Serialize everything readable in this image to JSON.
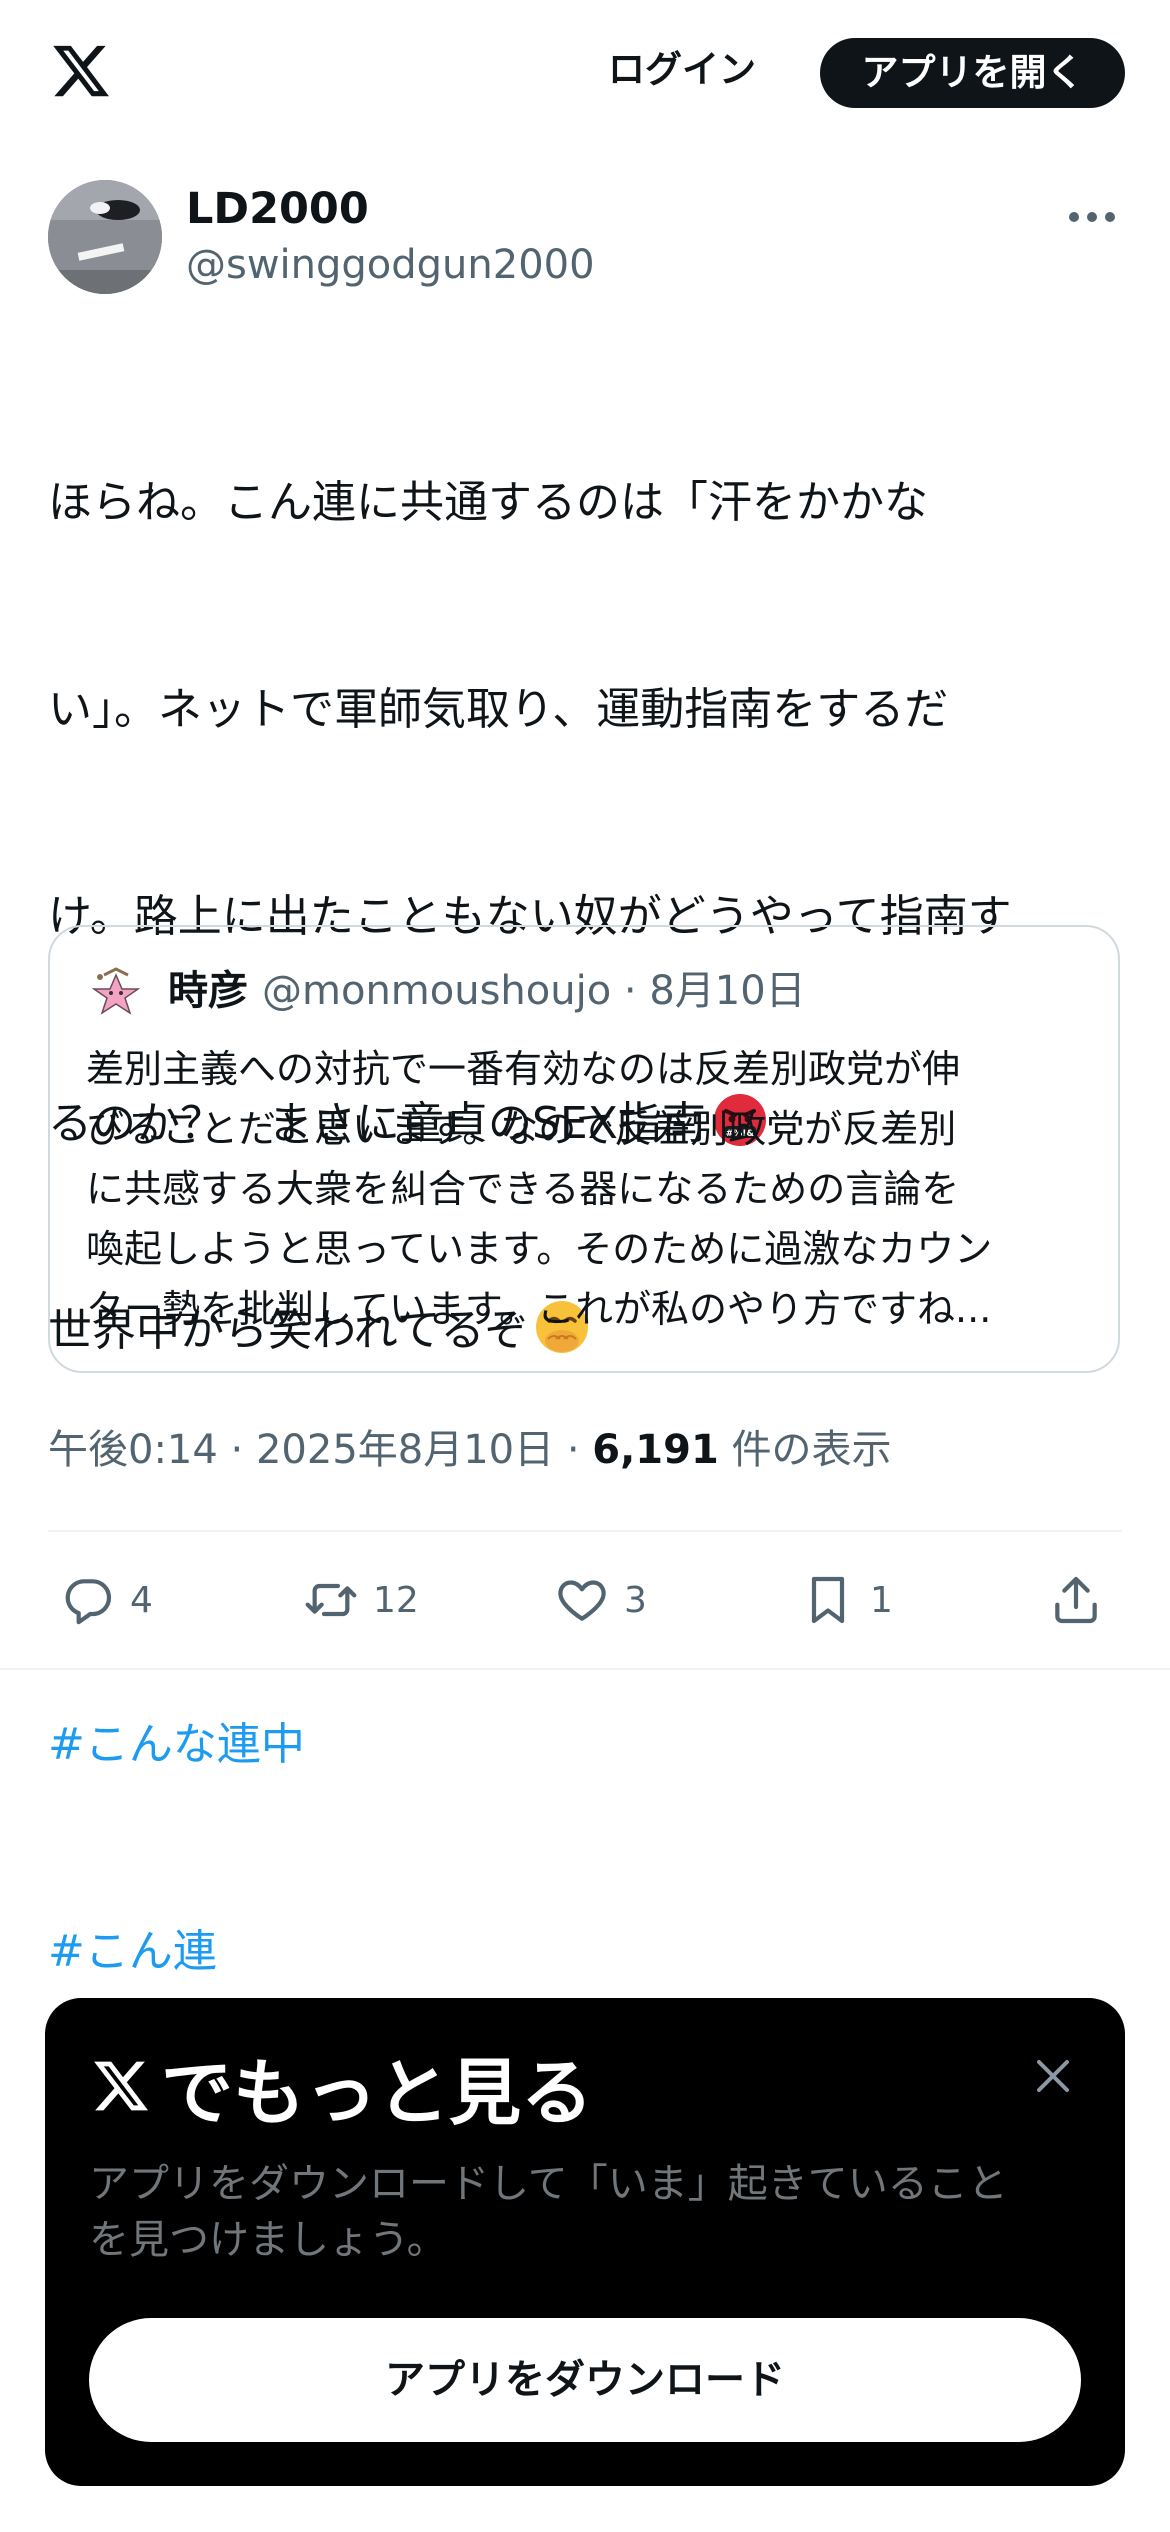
{
  "header": {
    "login_label": "ログイン",
    "open_app_label": "アプリを開く"
  },
  "post": {
    "author": {
      "display_name": "LD2000",
      "handle": "@swinggodgun2000"
    },
    "body_lines": [
      "ほらね。こん連に共通するのは「汗をかかな",
      "い」。ネットで軍師気取り、運動指南をするだ",
      "け。路上に出たこともない奴がどうやって指南す",
      "るのか？　まさに童貞のSEX指南",
      "世界中から笑われてるぞ"
    ],
    "emoji_line4": "cursing-face-emoji",
    "emoji_line5": "face-with-hand-over-mouth-emoji",
    "hashtags": [
      "#こんな連中",
      "#こん連"
    ],
    "quoted": {
      "display_name": "時彦",
      "meta": "@monmoushoujo · 8月10日",
      "body_lines": [
        "差別主義への対抗で一番有効なのは反差別政党が伸",
        "びることだと思います。なので反差別政党が反差別",
        "に共感する大衆を糾合できる器になるための言論を",
        "喚起しようと思っています。そのために過激なカウン",
        "ター勢を批判しています。これが私のやり方ですね..."
      ]
    },
    "timestamp": "午後0:14 · 2025年8月10日 · ",
    "views_count": "6,191",
    "views_label": " 件の表示",
    "actions": {
      "replies": "4",
      "reposts": "12",
      "likes": "3",
      "bookmarks": "1"
    }
  },
  "promo": {
    "title": "でもっと見る",
    "text_lines": [
      "アプリをダウンロードして「いま」起きていること",
      "を見つけましょう。"
    ],
    "download_label": "アプリをダウンロード"
  },
  "colors": {
    "text": "#0f1419",
    "secondary": "#536471",
    "link": "#1d9bf0",
    "border": "#cfd9de"
  }
}
